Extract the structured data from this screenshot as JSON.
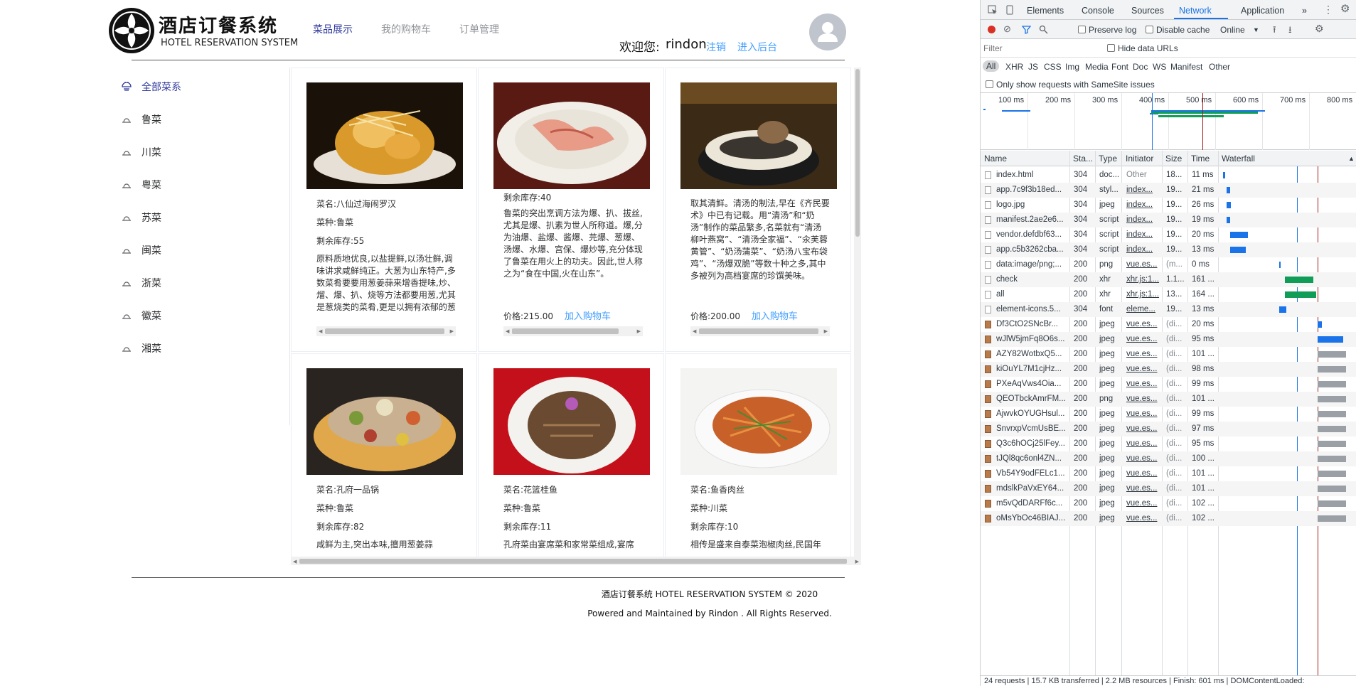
{
  "header": {
    "logo_cn": "酒店订餐系统",
    "logo_en": "HOTEL RESERVATION SYSTEM",
    "nav": [
      "菜品展示",
      "我的购物车",
      "订单管理"
    ],
    "welcome": "欢迎您:",
    "username": "rindon",
    "logout": "注销",
    "admin": "进入后台"
  },
  "sidebar": {
    "items": [
      {
        "label": "全部菜系",
        "active": true
      },
      {
        "label": "鲁菜"
      },
      {
        "label": "川菜"
      },
      {
        "label": "粤菜"
      },
      {
        "label": "苏菜"
      },
      {
        "label": "闽菜"
      },
      {
        "label": "浙菜"
      },
      {
        "label": "徽菜"
      },
      {
        "label": "湘菜"
      }
    ]
  },
  "cards": [
    {
      "lines": [
        "菜名:八仙过海闹罗汉",
        "菜种:鲁菜",
        "剩余库存:55"
      ],
      "desc": "原料质地优良,以盐提鲜,以汤壮鲜,调味讲求咸鲜纯正。大葱为山东特产,多数菜肴要要用葱姜蒜来增香提味,炒、熘、爆、扒、烧等方法都要用葱,尤其是葱烧类的菜肴,更是以拥有浓郁的葱香为佳,如葱烧海",
      "price": "",
      "add": ""
    },
    {
      "lines": [
        "剩余库存:40"
      ],
      "desc": "鲁菜的突出烹调方法为爆、扒、拔丝,尤其是爆、扒素为世人所称道。爆,分为油爆、盐爆、酱爆、芫爆、葱爆、汤爆、水爆、宫保、爆炒等,充分体现了鲁菜在用火上的功夫。因此,世人称之为“食在中国,火在山东”。",
      "price": "价格:215.00",
      "add": "加入购物车"
    },
    {
      "lines": [],
      "desc": "取其清鲜。清汤的制法,早在《齐民要术》中已有记载。用“清汤”和“奶汤”制作的菜品繁多,名菜就有“清汤柳叶燕窝”、“清汤全家福”、“氽芙蓉黄管”、“奶汤蒲菜”、“奶汤八宝布袋鸡”、“汤爆双脆”等数十种之多,其中多被列为高档宴席的珍馔美味。",
      "price": "价格:200.00",
      "add": "加入购物车"
    },
    {
      "lines": [
        "菜名:孔府一品锅",
        "菜种:鲁菜",
        "剩余库存:82"
      ],
      "desc": "咸鲜为主,突出本味,擅用葱姜蒜",
      "price": "",
      "add": ""
    },
    {
      "lines": [
        "菜名:花篮桂鱼",
        "菜种:鲁菜",
        "剩余库存:11"
      ],
      "desc": "孔府菜由宴席菜和家常菜组成,宴席",
      "price": "",
      "add": ""
    },
    {
      "lines": [
        "菜名:鱼香肉丝",
        "菜种:川菜",
        "剩余库存:10"
      ],
      "desc": "相传是盛来自泰菜泡椒肉丝,民国年",
      "price": "",
      "add": ""
    }
  ],
  "footer": {
    "line1": "酒店订餐系统 HOTEL RESERVATION SYSTEM © 2020",
    "line2": "Powered and Maintained by Rindon . All Rights Reserved."
  },
  "devtools": {
    "tabs": [
      "Elements",
      "Console",
      "Sources",
      "Network",
      "Application",
      "»"
    ],
    "active_tab": "Network",
    "preserve_log": "Preserve log",
    "disable_cache": "Disable cache",
    "throttle": "Online",
    "filter_placeholder": "Filter",
    "hide_data_urls": "Hide data URLs",
    "types": [
      "All",
      "XHR",
      "JS",
      "CSS",
      "Img",
      "Media",
      "Font",
      "Doc",
      "WS",
      "Manifest",
      "Other"
    ],
    "samesite": "Only show requests with SameSite issues",
    "overview_labels": [
      "100 ms",
      "200 ms",
      "300 ms",
      "400 ms",
      "500 ms",
      "600 ms",
      "700 ms",
      "800 ms"
    ],
    "columns": [
      "Name",
      "Sta...",
      "Type",
      "Initiator",
      "Size",
      "Time",
      "Waterfall"
    ],
    "rows": [
      {
        "name": "index.html",
        "status": "304",
        "type": "doc...",
        "initiator": "Other",
        "size": "18...",
        "time": "11 ms",
        "icon": "doc"
      },
      {
        "name": "app.7c9f3b18ed...",
        "status": "304",
        "type": "styl...",
        "initiator": "index...",
        "size": "19...",
        "time": "21 ms",
        "icon": "doc"
      },
      {
        "name": "logo.jpg",
        "status": "304",
        "type": "jpeg",
        "initiator": "index...",
        "size": "19...",
        "time": "26 ms",
        "icon": "doc"
      },
      {
        "name": "manifest.2ae2e6...",
        "status": "304",
        "type": "script",
        "initiator": "index...",
        "size": "19...",
        "time": "19 ms",
        "icon": "doc"
      },
      {
        "name": "vendor.defdbf63...",
        "status": "304",
        "type": "script",
        "initiator": "index...",
        "size": "19...",
        "time": "20 ms",
        "icon": "doc"
      },
      {
        "name": "app.c5b3262cba...",
        "status": "304",
        "type": "script",
        "initiator": "index...",
        "size": "19...",
        "time": "13 ms",
        "icon": "doc"
      },
      {
        "name": "data:image/png;...",
        "status": "200",
        "type": "png",
        "initiator": "vue.es...",
        "size": "(m...",
        "time": "0 ms",
        "icon": "doc"
      },
      {
        "name": "check",
        "status": "200",
        "type": "xhr",
        "initiator": "xhr.js:1...",
        "size": "1.1...",
        "time": "161 ...",
        "icon": "doc"
      },
      {
        "name": "all",
        "status": "200",
        "type": "xhr",
        "initiator": "xhr.js:1...",
        "size": "13...",
        "time": "164 ...",
        "icon": "doc"
      },
      {
        "name": "element-icons.5...",
        "status": "304",
        "type": "font",
        "initiator": "eleme...",
        "size": "19...",
        "time": "13 ms",
        "icon": "doc"
      },
      {
        "name": "Df3CtO2SNcBr...",
        "status": "200",
        "type": "jpeg",
        "initiator": "vue.es...",
        "size": "(di...",
        "time": "20 ms",
        "icon": "img"
      },
      {
        "name": "wJlW5jmFq8O6s...",
        "status": "200",
        "type": "jpeg",
        "initiator": "vue.es...",
        "size": "(di...",
        "time": "95 ms",
        "icon": "img"
      },
      {
        "name": "AZY82WotbxQ5...",
        "status": "200",
        "type": "jpeg",
        "initiator": "vue.es...",
        "size": "(di...",
        "time": "101 ...",
        "icon": "img"
      },
      {
        "name": "kiOuYL7M1cjHz...",
        "status": "200",
        "type": "jpeg",
        "initiator": "vue.es...",
        "size": "(di...",
        "time": "98 ms",
        "icon": "img"
      },
      {
        "name": "PXeAqVws4Oia...",
        "status": "200",
        "type": "jpeg",
        "initiator": "vue.es...",
        "size": "(di...",
        "time": "99 ms",
        "icon": "img"
      },
      {
        "name": "QEOTbckAmrFM...",
        "status": "200",
        "type": "png",
        "initiator": "vue.es...",
        "size": "(di...",
        "time": "101 ...",
        "icon": "img"
      },
      {
        "name": "AjwvkOYUGHsul...",
        "status": "200",
        "type": "jpeg",
        "initiator": "vue.es...",
        "size": "(di...",
        "time": "99 ms",
        "icon": "img"
      },
      {
        "name": "SnvrxpVcmUsBE...",
        "status": "200",
        "type": "jpeg",
        "initiator": "vue.es...",
        "size": "(di...",
        "time": "97 ms",
        "icon": "img"
      },
      {
        "name": "Q3c6hOCj25lFey...",
        "status": "200",
        "type": "jpeg",
        "initiator": "vue.es...",
        "size": "(di...",
        "time": "95 ms",
        "icon": "img"
      },
      {
        "name": "tJQl8qc6onl4ZN...",
        "status": "200",
        "type": "jpeg",
        "initiator": "vue.es...",
        "size": "(di...",
        "time": "100 ...",
        "icon": "img"
      },
      {
        "name": "Vb54Y9odFELc1...",
        "status": "200",
        "type": "jpeg",
        "initiator": "vue.es...",
        "size": "(di...",
        "time": "101 ...",
        "icon": "img"
      },
      {
        "name": "mdslkPaVxEY64...",
        "status": "200",
        "type": "jpeg",
        "initiator": "vue.es...",
        "size": "(di...",
        "time": "101 ...",
        "icon": "img"
      },
      {
        "name": "m5vQdDARFf6c...",
        "status": "200",
        "type": "jpeg",
        "initiator": "vue.es...",
        "size": "(di...",
        "time": "102 ...",
        "icon": "img"
      },
      {
        "name": "oMsYbOc46BIAJ...",
        "status": "200",
        "type": "jpeg",
        "initiator": "vue.es...",
        "size": "(di...",
        "time": "102 ...",
        "icon": "img"
      }
    ],
    "status_bar": "24 requests | 15.7 KB transferred | 2.2 MB resources | Finish: 601 ms | DOMContentLoaded:"
  }
}
